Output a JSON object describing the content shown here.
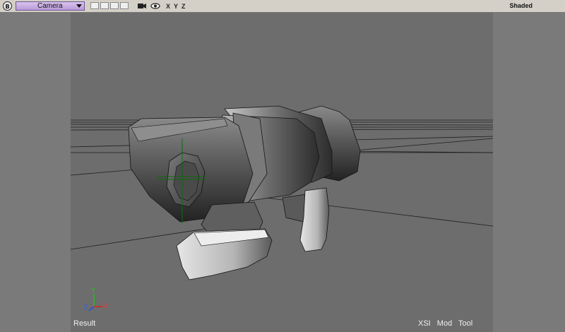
{
  "toolbar": {
    "view_letter": "B",
    "camera_label": "Camera",
    "axis_x": "X",
    "axis_y": "Y",
    "axis_z": "Z",
    "display_mode": "Shaded"
  },
  "viewport": {
    "status_left": "Result",
    "status_right": "XSI Mod Tool",
    "gizmo": {
      "x": "X",
      "y": "Y",
      "z": "Z"
    }
  }
}
